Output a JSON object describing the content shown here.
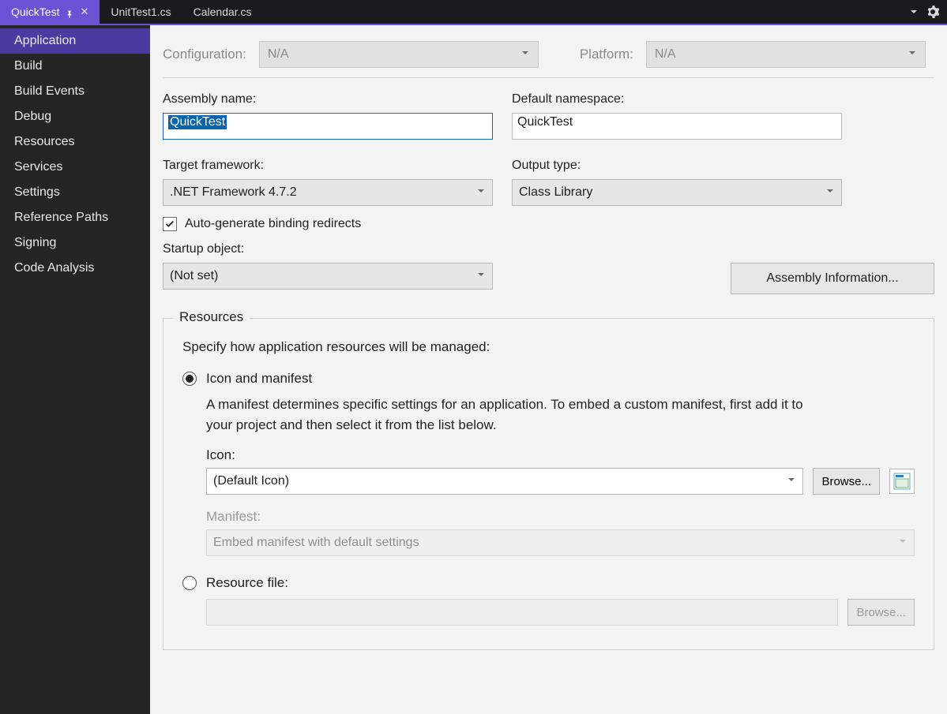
{
  "tabs": [
    {
      "label": "QuickTest",
      "pinned": true,
      "close": true,
      "active": true
    },
    {
      "label": "UnitTest1.cs",
      "active": false
    },
    {
      "label": "Calendar.cs",
      "active": false
    }
  ],
  "sidebar": {
    "items": [
      "Application",
      "Build",
      "Build Events",
      "Debug",
      "Resources",
      "Services",
      "Settings",
      "Reference Paths",
      "Signing",
      "Code Analysis"
    ],
    "active_index": 0
  },
  "top": {
    "configuration_label": "Configuration:",
    "configuration_value": "N/A",
    "platform_label": "Platform:",
    "platform_value": "N/A"
  },
  "form": {
    "assembly_name_label": "Assembly name:",
    "assembly_name_value": "QuickTest",
    "default_namespace_label": "Default namespace:",
    "default_namespace_value": "QuickTest",
    "target_framework_label": "Target framework:",
    "target_framework_value": ".NET Framework 4.7.2",
    "output_type_label": "Output type:",
    "output_type_value": "Class Library",
    "auto_generate_label": "Auto-generate binding redirects",
    "startup_object_label": "Startup object:",
    "startup_object_value": "(Not set)",
    "assembly_info_button": "Assembly Information..."
  },
  "resources": {
    "legend": "Resources",
    "description": "Specify how application resources will be managed:",
    "icon_manifest_label": "Icon and manifest",
    "icon_manifest_desc": "A manifest determines specific settings for an application. To embed a custom manifest, first add it to your project and then select it from the list below.",
    "icon_label": "Icon:",
    "icon_value": "(Default Icon)",
    "browse_button": "Browse...",
    "manifest_label": "Manifest:",
    "manifest_value": "Embed manifest with default settings",
    "resource_file_label": "Resource file:",
    "resource_browse_button": "Browse..."
  }
}
